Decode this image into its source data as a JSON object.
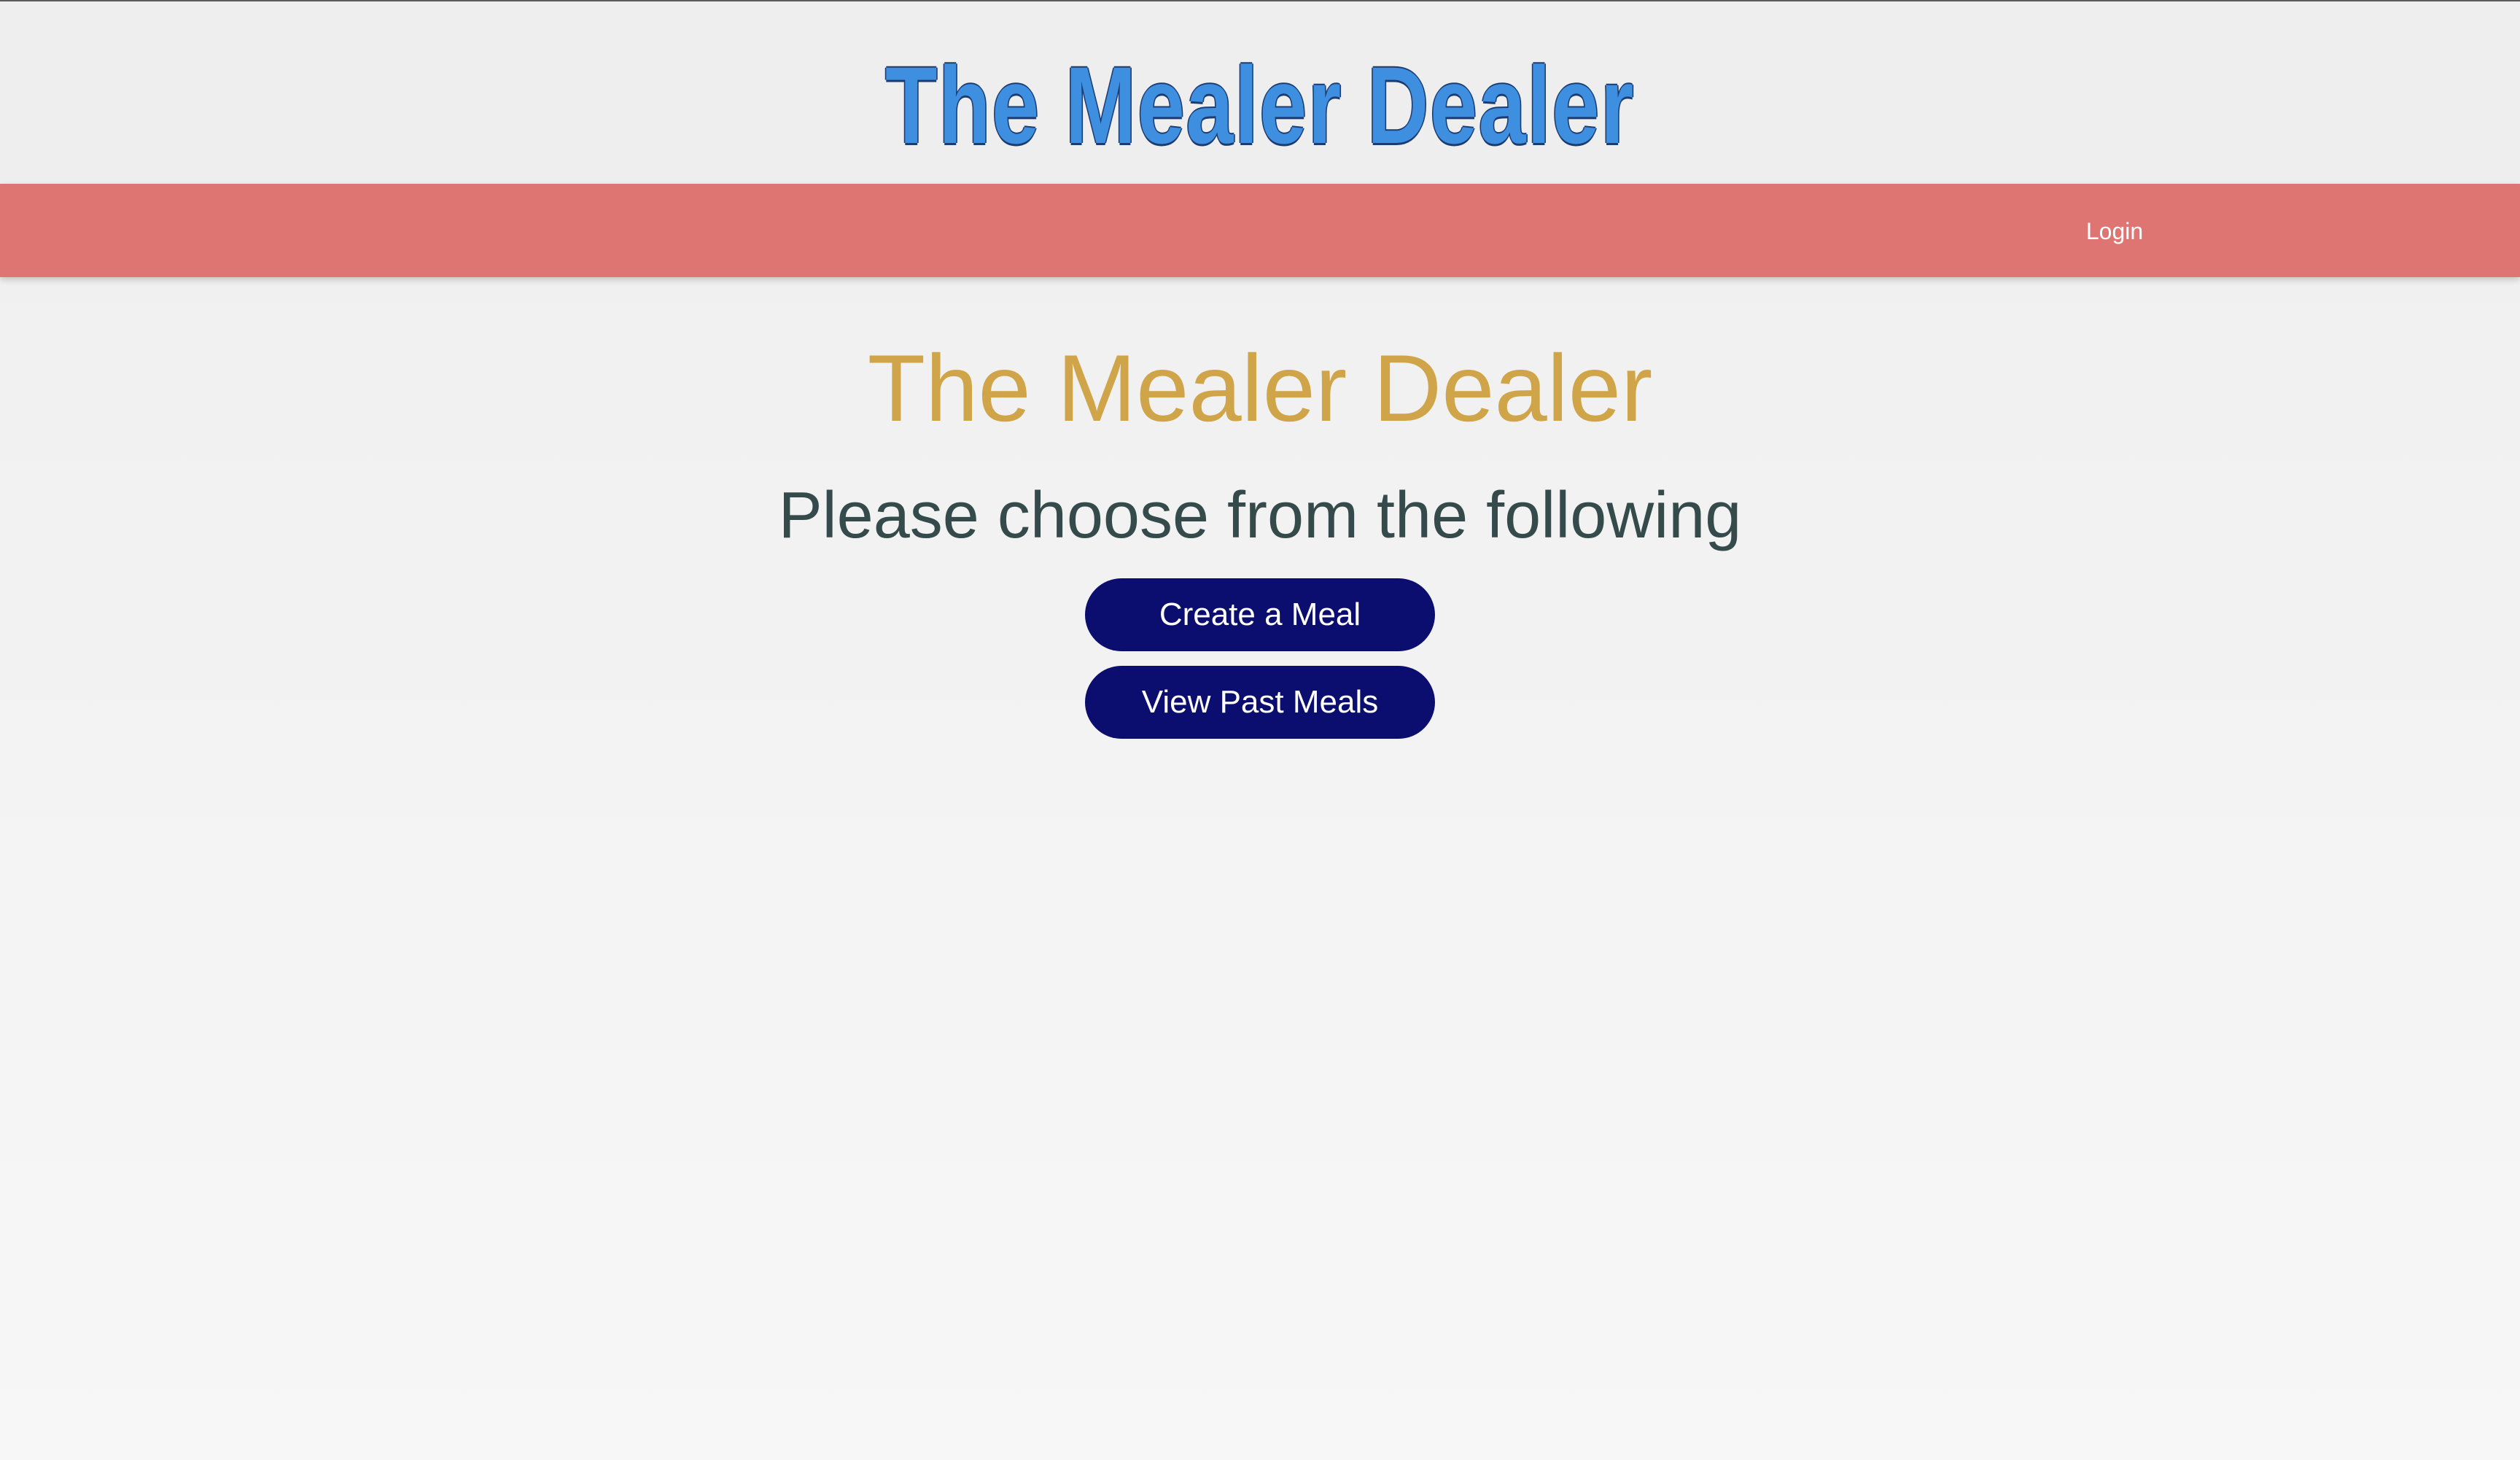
{
  "header": {
    "brand_title": "The Mealer Dealer"
  },
  "navbar": {
    "login_label": "Login"
  },
  "main": {
    "title": "The Mealer Dealer",
    "subtitle": "Please choose from the following",
    "buttons": [
      {
        "label": "Create a Meal"
      },
      {
        "label": "View Past Meals"
      }
    ]
  },
  "colors": {
    "brand_title": "#3f8fe0",
    "navbar": "#df7573",
    "main_title": "#d0a54a",
    "subtitle": "#354b4b",
    "button_bg": "#0b0e6e",
    "button_text": "#ffffff"
  }
}
